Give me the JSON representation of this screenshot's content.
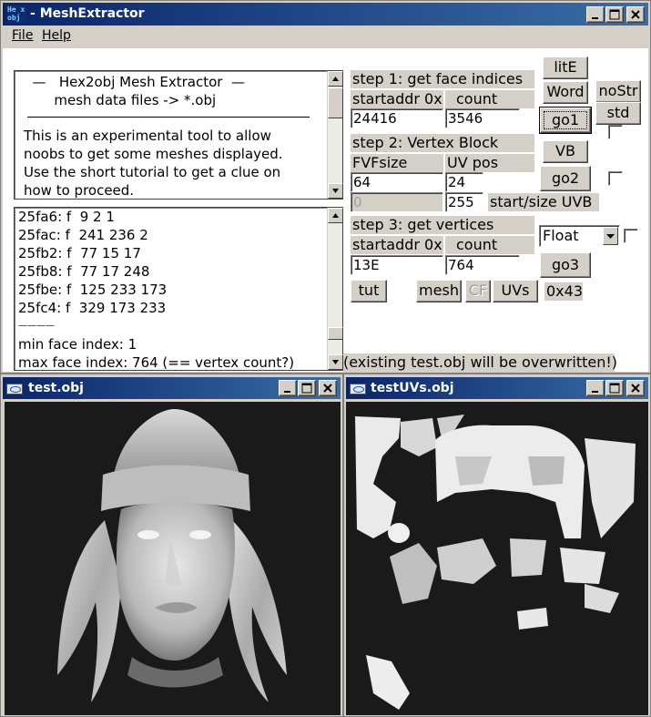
{
  "colors": {
    "face": "#d4d0c8",
    "titlebar_start": "#0a246a",
    "titlebar_end": "#3a6ea5",
    "viewport_bg": "#1a1a1a"
  },
  "main_window": {
    "title": "MeshExtractor",
    "icon_text": "He x\nobj",
    "caption_buttons": [
      "minimize-icon",
      "maximize-icon",
      "close-icon"
    ]
  },
  "menu": {
    "file": "File",
    "help": "Help"
  },
  "info_pane": {
    "lines": [
      "  —   Hex2obj Mesh Extractor  —",
      "       mesh data files -> *.obj",
      "",
      "This is an experimental tool to allow",
      "noobs to get some meshes displayed.",
      "Use the short tutorial to get a clue on",
      "how to proceed."
    ]
  },
  "log_pane": {
    "lines": [
      "25fa6: f  9 2 1",
      "25fac: f  241 236 2",
      "25fb2: f  77 15 17",
      "25fb8: f  77 17 248",
      "25fbe: f  125 233 173",
      "25fc4: f  329 173 233",
      "————",
      "min face index: 1",
      "max face index: 764 (== vertex count?)"
    ]
  },
  "step1": {
    "title": "step 1: get face indices",
    "startaddr_label": "startaddr 0x",
    "count_label": "count",
    "startaddr": "24416",
    "count": "3546",
    "go": "go1"
  },
  "step2": {
    "title": "step 2: Vertex Block",
    "fvf_label": "FVFsize",
    "uvpos_label": "UV pos",
    "fvfsize": "64",
    "uvpos": "24",
    "uvb_start": "0",
    "uvb_size": "255",
    "uvb_label": "start/size UVB",
    "go": "go2",
    "vb": "VB"
  },
  "step3": {
    "title": "step 3: get vertices",
    "startaddr_label": "startaddr 0x",
    "count_label": "count",
    "startaddr": "13E",
    "count": "764",
    "go": "go3",
    "format": "Float"
  },
  "side_buttons": {
    "lite": "litE",
    "word": "Word",
    "nostr": "noStr",
    "std": "std"
  },
  "bottom_buttons": {
    "tut": "tut",
    "mesh": "mesh",
    "cf": "CF",
    "uvs": "UVs",
    "hex": "0x43"
  },
  "status": "(existing test.obj will be overwritten!)",
  "view_left": {
    "title": "test.obj"
  },
  "view_right": {
    "title": "testUVs.obj"
  }
}
